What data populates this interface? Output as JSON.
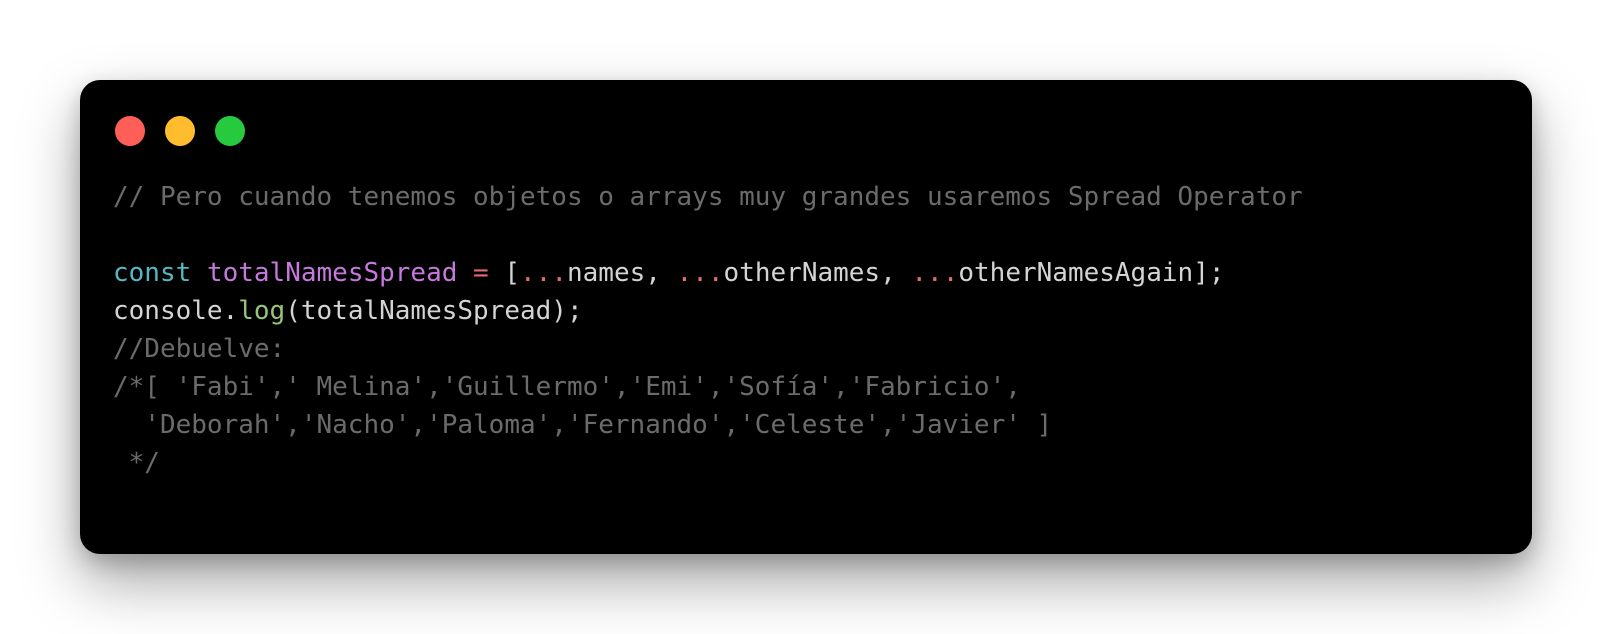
{
  "window": {
    "controls": [
      {
        "name": "close",
        "color": "#ff5f56"
      },
      {
        "name": "minimize",
        "color": "#ffbd2e"
      },
      {
        "name": "zoom",
        "color": "#27c93f"
      }
    ]
  },
  "code": {
    "line1": "// Pero cuando tenemos objetos o arrays muy grandes usaremos Spread Operator",
    "line3": {
      "kw": "const",
      "var": "totalNamesSpread",
      "eq": "=",
      "open": "[",
      "spread1": "...",
      "ident1": "names",
      "comma1": ", ",
      "spread2": "...",
      "ident2": "otherNames",
      "comma2": ", ",
      "spread3": "...",
      "ident3": "otherNamesAgain",
      "close": "];"
    },
    "line4": {
      "obj": "console",
      "dot": ".",
      "method": "log",
      "args": "(totalNamesSpread);"
    },
    "line5": "//Debuelve:",
    "line6": "/*[ 'Fabi',' Melina','Guillermo','Emi','Sofía','Fabricio',",
    "line7": "  'Deborah','Nacho','Paloma','Fernando','Celeste','Javier' ]",
    "line8": " */"
  }
}
